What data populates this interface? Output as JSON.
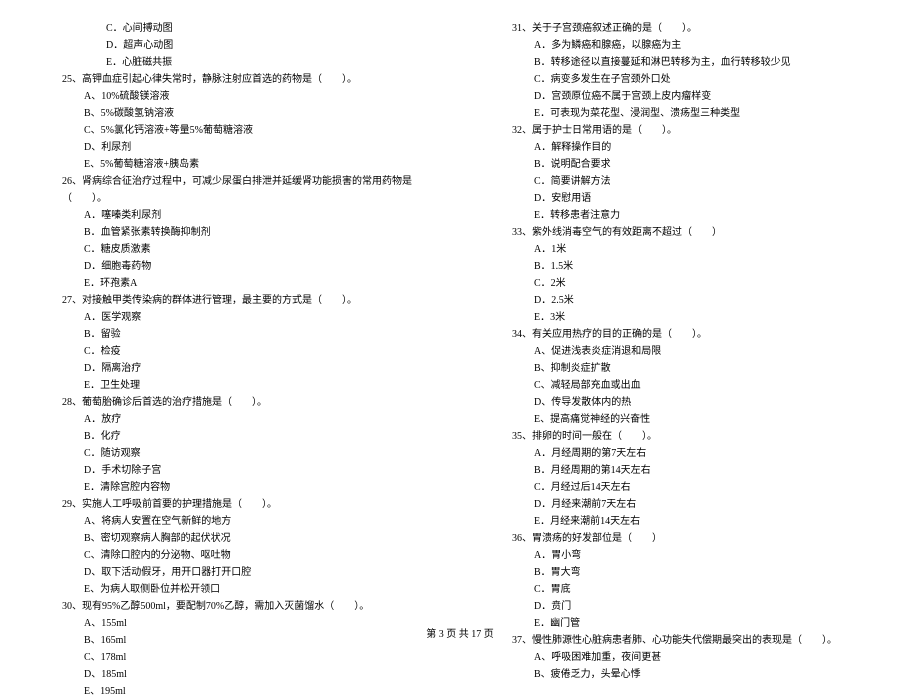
{
  "left_column": {
    "opts_24": [
      "C．心间搏动图",
      "D．超声心动图",
      "E．心脏磁共振"
    ],
    "q25": "25、高钾血症引起心律失常时，静脉注射应首选的药物是（　　）。",
    "opts_25": [
      "A、10%硫酸镁溶液",
      "B、5%碳酸氢钠溶液",
      "C、5%氯化钙溶液+等量5%葡萄糖溶液",
      "D、利尿剂",
      "E、5%葡萄糖溶液+胰岛素"
    ],
    "q26": "26、肾病综合征治疗过程中，可减少尿蛋白排泄并延缓肾功能损害的常用药物是（　　）。",
    "opts_26": [
      "A．噻嗪类利尿剂",
      "B．血管紧张素转换酶抑制剂",
      "C．糖皮质激素",
      "D．细胞毒药物",
      "E．环孢素A"
    ],
    "q27": "27、对接触甲类传染病的群体进行管理，最主要的方式是（　　）。",
    "opts_27": [
      "A．医学观察",
      "B．留验",
      "C．检疫",
      "D．隔离治疗",
      "E．卫生处理"
    ],
    "q28": "28、葡萄胎确诊后首选的治疗措施是（　　）。",
    "opts_28": [
      "A．放疗",
      "B．化疗",
      "C．随访观察",
      "D．手术切除子宫",
      "E．清除宫腔内容物"
    ],
    "q29": "29、实施人工呼吸前首要的护理措施是（　　）。",
    "opts_29": [
      "A、将病人安置在空气新鲜的地方",
      "B、密切观察病人胸部的起伏状况",
      "C、清除口腔内的分泌物、呕吐物",
      "D、取下活动假牙，用开口器打开口腔",
      "E、为病人取侧卧位并松开领口"
    ],
    "q30": "30、现有95%乙醇500ml，要配制70%乙醇，需加入灭菌馏水（　　）。",
    "opts_30": [
      "A、155ml",
      "B、165ml",
      "C、178ml",
      "D、185ml",
      "E、195ml"
    ]
  },
  "right_column": {
    "q31": "31、关于子宫颈癌叙述正确的是（　　）。",
    "opts_31": [
      "A．多为鳞癌和腺癌，以腺癌为主",
      "B．转移途径以直接蔓延和淋巴转移为主，血行转移较少见",
      "C．病变多发生在子宫颈外口处",
      "D．宫颈原位癌不属于宫颈上皮内瘤样变",
      "E．可表现为菜花型、浸润型、溃疡型三种类型"
    ],
    "q32": "32、属于护士日常用语的是（　　）。",
    "opts_32": [
      "A．解释操作目的",
      "B．说明配合要求",
      "C．简要讲解方法",
      "D．安慰用语",
      "E．转移患者注意力"
    ],
    "q33": "33、紫外线消毒空气的有效距离不超过（　　）",
    "opts_33": [
      "A．1米",
      "B．1.5米",
      "C．2米",
      "D．2.5米",
      "E．3米"
    ],
    "q34": "34、有关应用热疗的目的正确的是（　　）。",
    "opts_34": [
      "A、促进浅表炎症消退和局限",
      "B、抑制炎症扩散",
      "C、减轻局部充血或出血",
      "D、传导发散体内的热",
      "E、提高痛觉神经的兴奋性"
    ],
    "q35": "35、排卵的时间一般在（　　）。",
    "opts_35": [
      "A．月经周期的第7天左右",
      "B．月经周期的第14天左右",
      "C．月经过后14天左右",
      "D．月经来潮前7天左右",
      "E．月经来潮前14天左右"
    ],
    "q36": "36、胃溃疡的好发部位是（　　）",
    "opts_36": [
      "A．胃小弯",
      "B．胃大弯",
      "C．胃底",
      "D．贲门",
      "E．幽门管"
    ],
    "q37": "37、慢性肺源性心脏病患者肺、心功能失代偿期最突出的表现是（　　）。",
    "opts_37": [
      "A、呼吸困难加重，夜间更甚",
      "B、疲倦乏力，头晕心悸"
    ]
  },
  "footer": "第 3 页 共 17 页"
}
